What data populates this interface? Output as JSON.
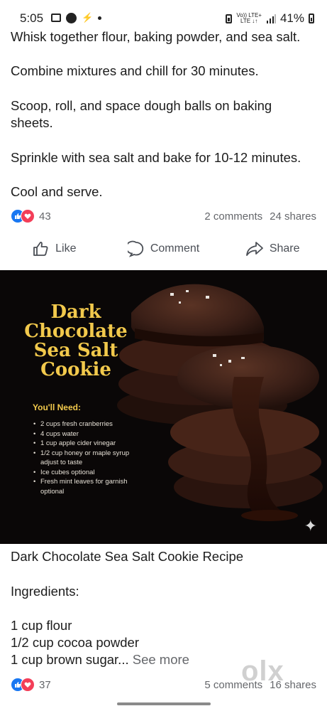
{
  "status_bar": {
    "time": "5:05",
    "network_top": "Vo)) LTE+",
    "network_bottom": "LTE ↓↑",
    "battery": "41%"
  },
  "post1": {
    "paragraphs": [
      "Whisk together flour, baking powder, and sea salt.",
      "Combine mixtures and chill for 30 minutes.",
      "Scoop, roll, and space dough balls on baking sheets.",
      "Sprinkle with sea salt and bake for 10-12 minutes.",
      "Cool and serve."
    ],
    "reaction_count": "43",
    "comments": "2 comments",
    "shares": "24 shares"
  },
  "actions": {
    "like": "Like",
    "comment": "Comment",
    "share": "Share"
  },
  "image_card": {
    "title_lines": [
      "Dark",
      "Chocolate",
      "Sea Salt",
      "Cookie"
    ],
    "need_heading": "You'll Need:",
    "ingredients": [
      "2 cups fresh cranberries",
      "4 cups water",
      "1 cup apple cider vinegar",
      "1/2 cup honey or maple syrup adjust to taste",
      "Ice cubes optional",
      "Fresh mint leaves for garnish optional"
    ]
  },
  "post2": {
    "title": "Dark Chocolate Sea Salt Cookie Recipe",
    "ingredients_label": "Ingredients:",
    "line1": "1 cup flour",
    "line2": "1/2 cup cocoa powder",
    "line3": "1 cup brown sugar...",
    "see_more": "See more",
    "reaction_count": "37",
    "comments": "5 comments",
    "shares": "16 shares"
  },
  "watermark": "olx",
  "colors": {
    "like_blue": "#1877f2",
    "love_red": "#f33e58",
    "gold": "#f2c94c"
  }
}
